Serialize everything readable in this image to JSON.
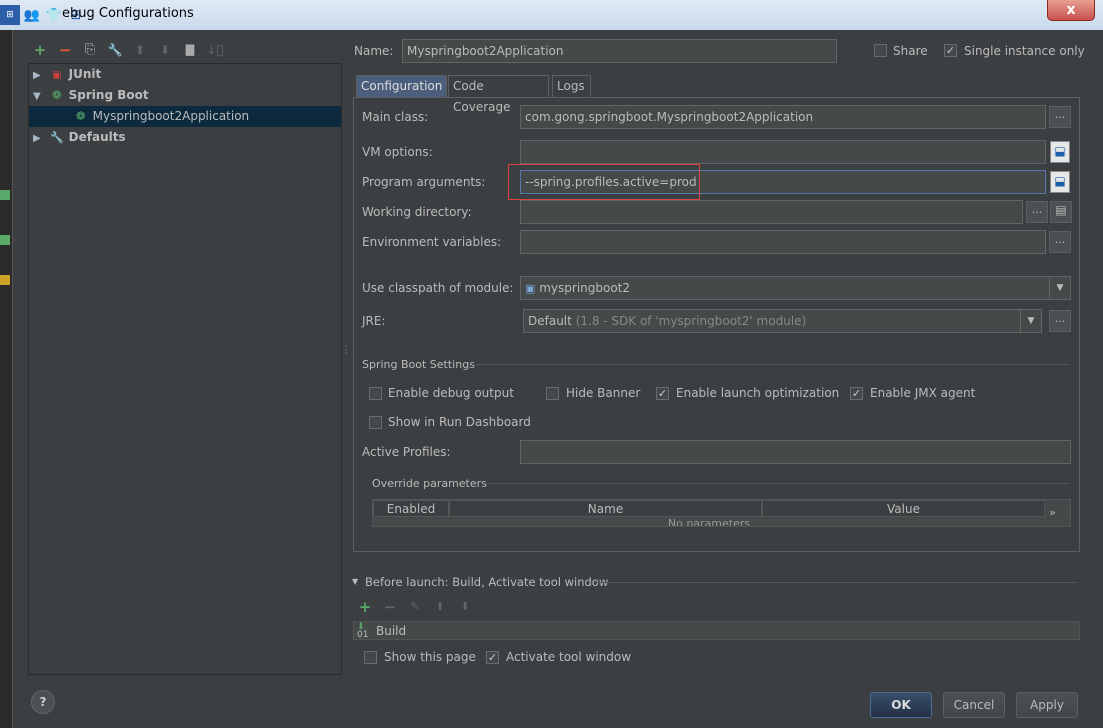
{
  "window": {
    "title": "ebug Configurations",
    "close_label": "x"
  },
  "toolbar": {
    "add": "+",
    "remove": "−",
    "copy": "⎘",
    "edit_defaults": "🔧",
    "move_up": "⬆",
    "move_down": "⬇",
    "folder": "▇",
    "sort": "↓⃟"
  },
  "tree": {
    "junit": "JUnit",
    "spring_boot": "Spring Boot",
    "app": "Myspringboot2Application",
    "defaults": "Defaults"
  },
  "name_label": "Name:",
  "name_value": "Myspringboot2Application",
  "share_label": "Share",
  "single_instance_label": "Single instance only",
  "tabs": [
    "Configuration",
    "Code Coverage",
    "Logs"
  ],
  "form": {
    "main_class_label": "Main class:",
    "main_class_value": "com.gong.springboot.Myspringboot2Application",
    "vm_options_label": "VM options:",
    "program_args_label": "Program arguments:",
    "program_args_value": "--spring.profiles.active=prod",
    "working_dir_label": "Working directory:",
    "env_vars_label": "Environment variables:",
    "classpath_label": "Use classpath of module:",
    "classpath_value": "myspringboot2",
    "jre_label": "JRE:",
    "jre_value": "Default",
    "jre_hint": "(1.8 - SDK of 'myspringboot2' module)"
  },
  "spring_settings": {
    "header": "Spring Boot Settings",
    "debug_output": "Enable debug output",
    "hide_banner": "Hide Banner",
    "launch_opt": "Enable launch optimization",
    "jmx": "Enable JMX agent",
    "run_dashboard": "Show in Run Dashboard",
    "active_profiles_label": "Active Profiles:",
    "override_header": "Override parameters",
    "columns": [
      "Enabled",
      "Name",
      "Value"
    ],
    "empty_text": "No parameters",
    "more": "»"
  },
  "before_launch": {
    "header": "Before launch: Build, Activate tool window",
    "item": "Build",
    "show_page": "Show this page",
    "activate_tool_window": "Activate tool window"
  },
  "buttons": {
    "help": "?",
    "ok": "OK",
    "cancel": "Cancel",
    "apply": "Apply"
  },
  "colors": {
    "background": "#3c3f41",
    "accent_green": "#59a869",
    "highlight_red": "#e04040",
    "selection": "#0d293e"
  }
}
